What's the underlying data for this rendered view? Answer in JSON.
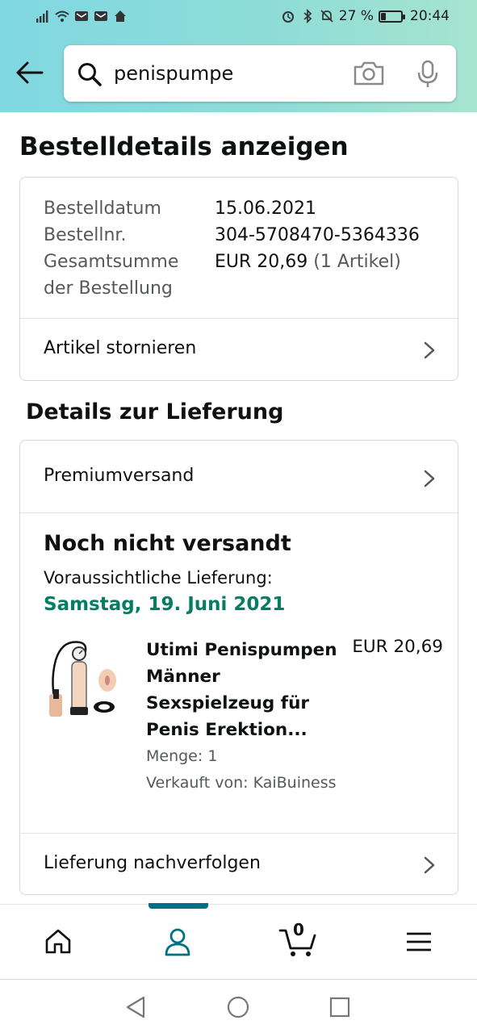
{
  "status_bar": {
    "battery_percent": "27 %",
    "time": "20:44",
    "battery_level": 0.27
  },
  "search": {
    "value": "penispumpe"
  },
  "page": {
    "title": "Bestelldetails anzeigen"
  },
  "order_summary": {
    "date_label": "Bestelldatum",
    "date_value": "15.06.2021",
    "number_label": "Bestellnr.",
    "number_value": "304-5708470-5364336",
    "total_label_line1": "Gesamtsumme",
    "total_label_line2": "der Bestellung",
    "total_value": "EUR 20,69",
    "total_items": "(1 Artikel)",
    "cancel_label": "Artikel stornieren"
  },
  "delivery": {
    "section_title": "Details zur Lieferung",
    "shipping_method": "Premiumversand",
    "status": "Noch nicht versandt",
    "eta_label": "Voraussichtliche Lieferung:",
    "eta_date": "Samstag, 19. Juni 2021",
    "track_label": "Lieferung nachverfolgen"
  },
  "product": {
    "title": "Utimi Penispumpen Männer Sexspielzeug für Penis Erektion...",
    "price": "EUR 20,69",
    "quantity": "Menge: 1",
    "seller": "Verkauft von: KaiBuiness"
  },
  "bottom_nav": {
    "cart_count": "0",
    "items": [
      "home-icon",
      "account-icon",
      "cart-icon",
      "menu-icon"
    ],
    "active": "account-icon"
  },
  "colors": {
    "header_start": "#80d8e1",
    "header_end": "#a6e4cf",
    "eta_green": "#067d62",
    "accent_teal": "#007185"
  }
}
